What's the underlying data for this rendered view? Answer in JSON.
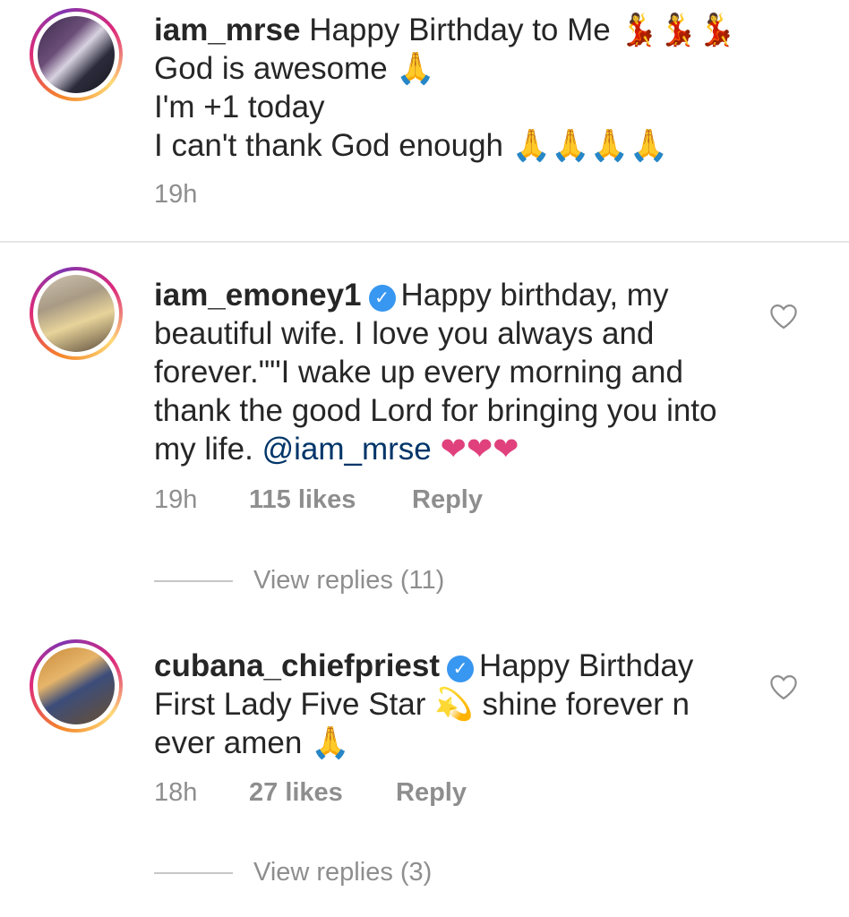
{
  "caption": {
    "username": "iam_mrse",
    "line1_text": "Happy Birthday to Me",
    "line1_emoji": "💃💃💃",
    "line2_text": "God is awesome",
    "line2_emoji": "🙏",
    "line3_text": "I'm +1 today",
    "line4_text": "I can't thank God enough",
    "line4_emoji": "🙏🙏🙏🙏",
    "time": "19h"
  },
  "comments": [
    {
      "username": "iam_emoney1",
      "verified_mark": "✓",
      "text": "Happy birthday, my beautiful wife. I love you always and forever.\"\"I wake up every morning and thank the good Lord for bringing you into my life.",
      "mention": "@iam_mrse",
      "emoji": "❤❤❤",
      "time": "19h",
      "likes": "115 likes",
      "reply_label": "Reply",
      "view_replies": "View replies (11)"
    },
    {
      "username": "cubana_chiefpriest",
      "verified_mark": "✓",
      "text_part1": "Happy Birthday First Lady Five Star",
      "star_emoji": "💫",
      "text_part2": "shine forever n ever amen",
      "emoji": "🙏",
      "time": "18h",
      "likes": "27 likes",
      "reply_label": "Reply",
      "view_replies": "View replies (3)"
    }
  ],
  "icons": {
    "like": "heart-outline-icon",
    "verified": "verified-badge-icon"
  },
  "colors": {
    "text": "#262626",
    "meta": "#8e8e8e",
    "mention": "#003569",
    "verified": "#3897f0"
  }
}
